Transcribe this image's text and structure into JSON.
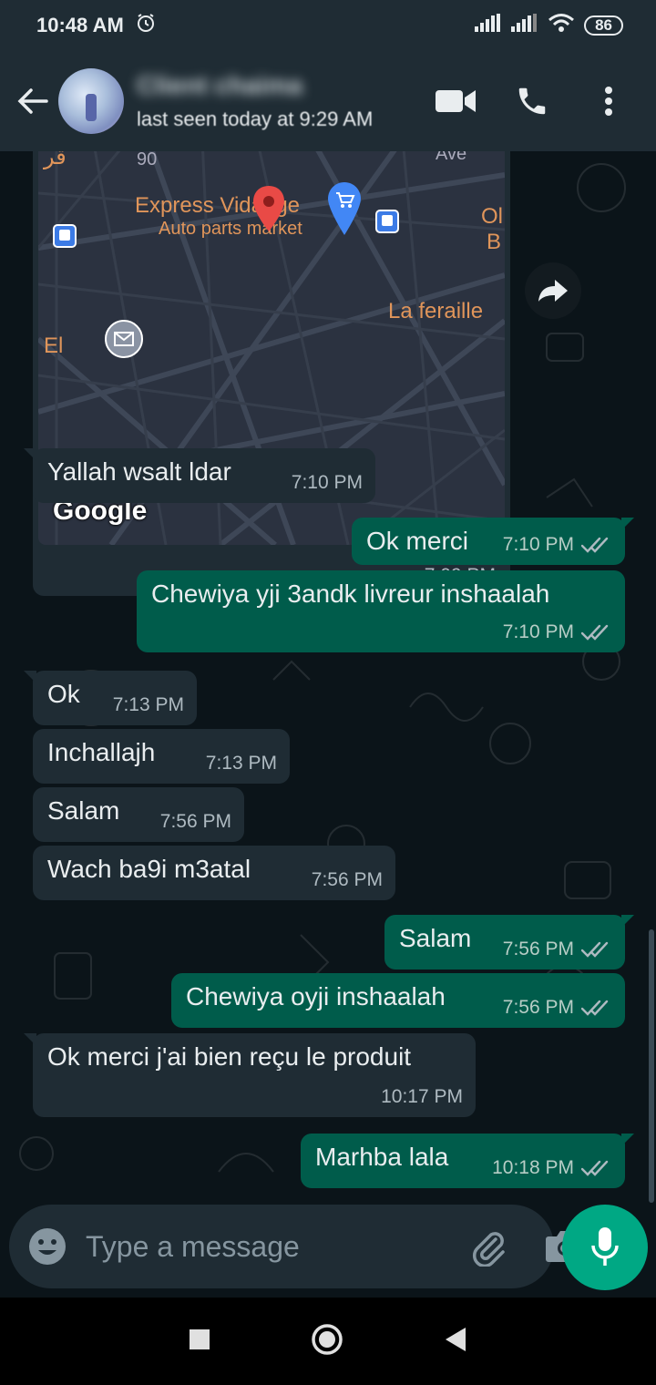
{
  "status_bar": {
    "time": "10:48 AM",
    "battery": "86"
  },
  "header": {
    "contact_name": "Client chaima",
    "last_seen": "last seen today at 9:29 AM"
  },
  "map_message": {
    "labels": {
      "place": "Express Vidange",
      "category": "Auto parts market",
      "feraille": "La feraille",
      "street_90": "90",
      "avenue": "Ave",
      "ol": "Ol",
      "b": "B",
      "arabic": "قر",
      "el": "El"
    },
    "google": "Google",
    "time": "7:09 PM"
  },
  "messages": [
    {
      "dir": "in",
      "text": "Yallah wsalt ldar",
      "time": "7:10 PM"
    },
    {
      "dir": "out",
      "text": "Ok merci",
      "time": "7:10 PM"
    },
    {
      "dir": "out",
      "text": "Chewiya yji 3andk livreur inshaalah",
      "time": "7:10 PM"
    },
    {
      "dir": "in",
      "text": "Ok",
      "time": "7:13 PM"
    },
    {
      "dir": "in",
      "text": "Inchallajh",
      "time": "7:13 PM"
    },
    {
      "dir": "in",
      "text": "Salam",
      "time": "7:56 PM"
    },
    {
      "dir": "in",
      "text": "Wach ba9i m3atal",
      "time": "7:56 PM"
    },
    {
      "dir": "out",
      "text": "Salam",
      "time": "7:56 PM"
    },
    {
      "dir": "out",
      "text": "Chewiya oyji inshaalah",
      "time": "7:56 PM"
    },
    {
      "dir": "in",
      "text": "Ok merci j'ai bien reçu le produit",
      "time": "10:17 PM"
    },
    {
      "dir": "out",
      "text": "Marhba lala",
      "time": "10:18 PM"
    }
  ],
  "composer": {
    "placeholder": "Type a message"
  },
  "colors": {
    "incoming": "#1f2c34",
    "outgoing": "#005c4b",
    "accent": "#00a884"
  },
  "icons": {
    "back": "back-arrow-icon",
    "video": "video-call-icon",
    "call": "phone-icon",
    "menu": "more-vert-icon",
    "emoji": "emoji-icon",
    "attach": "paperclip-icon",
    "camera": "camera-icon",
    "mic": "mic-icon",
    "forward": "forward-icon",
    "read": "double-check-icon"
  }
}
